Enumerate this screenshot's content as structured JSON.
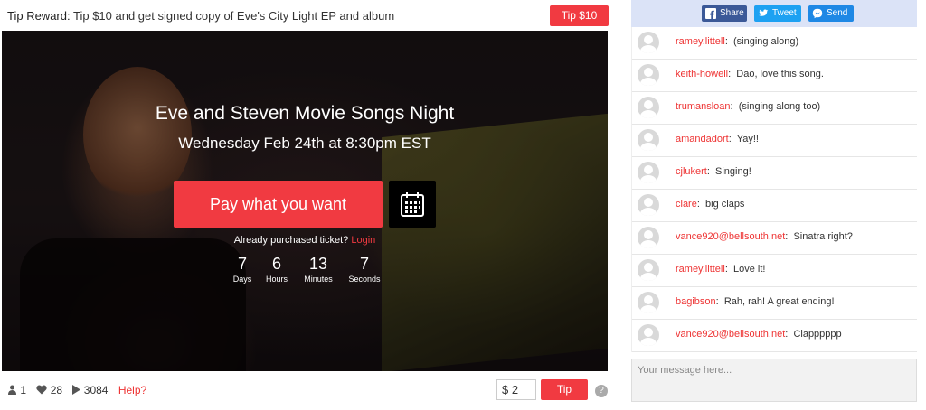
{
  "tip_bar": {
    "label": "Tip Reward:",
    "text": "Tip $10 and get signed copy of Eve's City Light EP and album",
    "button": "Tip $10"
  },
  "event": {
    "title": "Eve and Steven Movie Songs Night",
    "date": "Wednesday Feb 24th at 8:30pm EST",
    "pay_button": "Pay what you want",
    "calendar_icon": "calendar-icon",
    "purchased_text": "Already purchased ticket?",
    "login_link": "Login",
    "countdown": [
      {
        "value": "7",
        "label": "Days"
      },
      {
        "value": "6",
        "label": "Hours"
      },
      {
        "value": "13",
        "label": "Minutes"
      },
      {
        "value": "7",
        "label": "Seconds"
      }
    ]
  },
  "stats": {
    "viewers": "1",
    "likes": "28",
    "plays": "3084",
    "help": "Help?"
  },
  "tip_input": {
    "value": "$ 2",
    "button": "Tip",
    "help_icon": "?"
  },
  "share": {
    "facebook": "Share",
    "twitter": "Tweet",
    "messenger": "Send"
  },
  "chat": {
    "messages": [
      {
        "user": "ramey.littell",
        "text": "(singing along)"
      },
      {
        "user": "keith-howell",
        "text": "Dao, love this song."
      },
      {
        "user": "trumansloan",
        "text": "(singing along too)"
      },
      {
        "user": "amandadort",
        "text": "Yay!!"
      },
      {
        "user": "cjlukert",
        "text": "Singing!"
      },
      {
        "user": "clare",
        "text": "big claps"
      },
      {
        "user": "vance920@bellsouth.net",
        "text": "Sinatra right?"
      },
      {
        "user": "ramey.littell",
        "text": "Love it!"
      },
      {
        "user": "bagibson",
        "text": "Rah, rah! A great ending!"
      },
      {
        "user": "vance920@bellsouth.net",
        "text": "Clapppppp"
      }
    ],
    "input_placeholder": "Your message here..."
  },
  "colors": {
    "accent": "#f13a41",
    "share_bar": "#dbe3f7",
    "facebook": "#3b5998",
    "twitter": "#1da1f2",
    "messenger": "#1e88e5"
  }
}
